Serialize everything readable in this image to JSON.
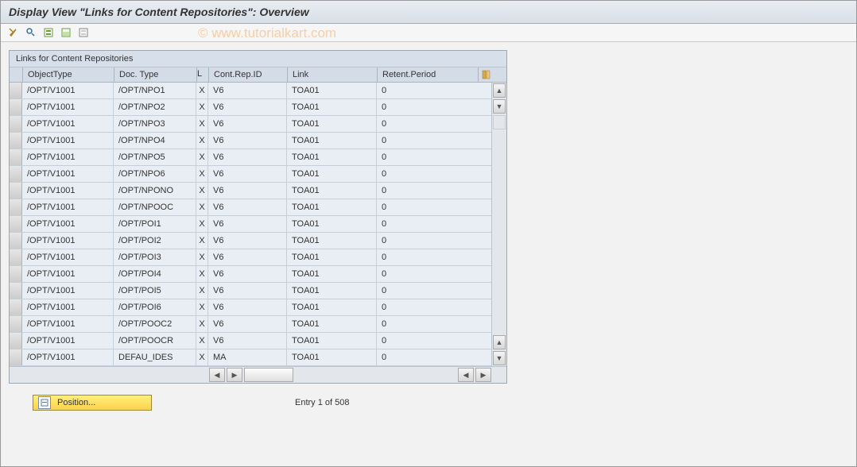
{
  "title": "Display View \"Links for Content Repositories\": Overview",
  "watermark": "© www.tutorialkart.com",
  "table": {
    "title": "Links for Content Repositories",
    "headers": {
      "object_type": "ObjectType",
      "doc_type": "Doc. Type",
      "l": "L",
      "cont_rep_id": "Cont.Rep.ID",
      "link": "Link",
      "retent_period": "Retent.Period"
    },
    "rows": [
      {
        "obj": "/OPT/V1001",
        "doc": "/OPT/NPO1",
        "l": "X",
        "rep": "V6",
        "link": "TOA01",
        "ret": "0"
      },
      {
        "obj": "/OPT/V1001",
        "doc": "/OPT/NPO2",
        "l": "X",
        "rep": "V6",
        "link": "TOA01",
        "ret": "0"
      },
      {
        "obj": "/OPT/V1001",
        "doc": "/OPT/NPO3",
        "l": "X",
        "rep": "V6",
        "link": "TOA01",
        "ret": "0"
      },
      {
        "obj": "/OPT/V1001",
        "doc": "/OPT/NPO4",
        "l": "X",
        "rep": "V6",
        "link": "TOA01",
        "ret": "0"
      },
      {
        "obj": "/OPT/V1001",
        "doc": "/OPT/NPO5",
        "l": "X",
        "rep": "V6",
        "link": "TOA01",
        "ret": "0"
      },
      {
        "obj": "/OPT/V1001",
        "doc": "/OPT/NPO6",
        "l": "X",
        "rep": "V6",
        "link": "TOA01",
        "ret": "0"
      },
      {
        "obj": "/OPT/V1001",
        "doc": "/OPT/NPONO",
        "l": "X",
        "rep": "V6",
        "link": "TOA01",
        "ret": "0"
      },
      {
        "obj": "/OPT/V1001",
        "doc": "/OPT/NPOOC",
        "l": "X",
        "rep": "V6",
        "link": "TOA01",
        "ret": "0"
      },
      {
        "obj": "/OPT/V1001",
        "doc": "/OPT/POI1",
        "l": "X",
        "rep": "V6",
        "link": "TOA01",
        "ret": "0"
      },
      {
        "obj": "/OPT/V1001",
        "doc": "/OPT/POI2",
        "l": "X",
        "rep": "V6",
        "link": "TOA01",
        "ret": "0"
      },
      {
        "obj": "/OPT/V1001",
        "doc": "/OPT/POI3",
        "l": "X",
        "rep": "V6",
        "link": "TOA01",
        "ret": "0"
      },
      {
        "obj": "/OPT/V1001",
        "doc": "/OPT/POI4",
        "l": "X",
        "rep": "V6",
        "link": "TOA01",
        "ret": "0"
      },
      {
        "obj": "/OPT/V1001",
        "doc": "/OPT/POI5",
        "l": "X",
        "rep": "V6",
        "link": "TOA01",
        "ret": "0"
      },
      {
        "obj": "/OPT/V1001",
        "doc": "/OPT/POI6",
        "l": "X",
        "rep": "V6",
        "link": "TOA01",
        "ret": "0"
      },
      {
        "obj": "/OPT/V1001",
        "doc": "/OPT/POOC2",
        "l": "X",
        "rep": "V6",
        "link": "TOA01",
        "ret": "0"
      },
      {
        "obj": "/OPT/V1001",
        "doc": "/OPT/POOCR",
        "l": "X",
        "rep": "V6",
        "link": "TOA01",
        "ret": "0"
      },
      {
        "obj": "/OPT/V1001",
        "doc": "DEFAU_IDES",
        "l": "X",
        "rep": "MA",
        "link": "TOA01",
        "ret": "0"
      }
    ]
  },
  "footer": {
    "position_label": "Position...",
    "entry_text": "Entry 1 of 508"
  }
}
